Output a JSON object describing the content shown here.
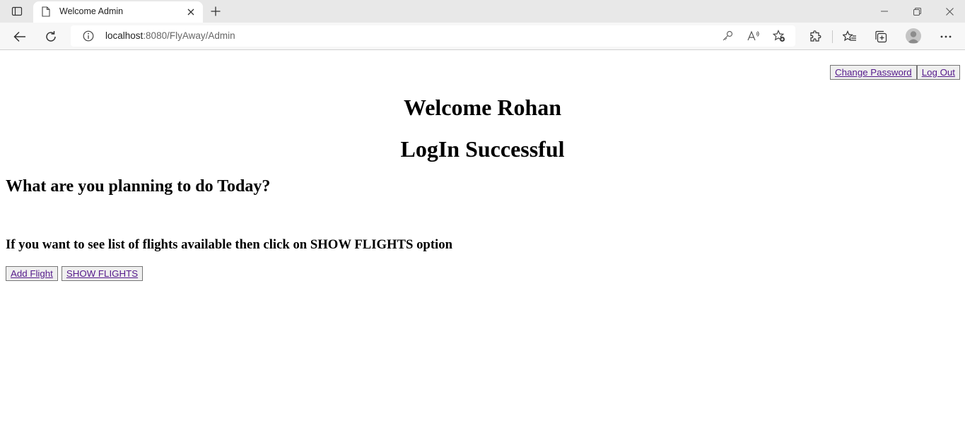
{
  "browser": {
    "tab": {
      "title": "Welcome Admin",
      "favicon": "page-icon"
    },
    "address": {
      "host": "localhost",
      "path": ":8080/FlyAway/Admin"
    },
    "toolbar_icons": [
      "back-icon",
      "refresh-icon",
      "info-icon",
      "key-icon",
      "read-aloud-icon",
      "add-favorite-icon",
      "extensions-icon",
      "favorites-icon",
      "collections-icon",
      "profile-avatar",
      "more-icon"
    ],
    "window_controls": [
      "minimize-icon",
      "restore-icon",
      "close-icon"
    ]
  },
  "page": {
    "top_links": {
      "change_password": "Change Password",
      "log_out": "Log Out"
    },
    "welcome": "Welcome Rohan",
    "login_status": "LogIn Successful",
    "question": "What are you planning to do Today?",
    "info": "If you want to see list of flights available then click on SHOW FLIGHTS option",
    "actions": {
      "add_flight": "Add Flight",
      "show_flights": "SHOW FLIGHTS"
    },
    "link_color": "#551a8b"
  }
}
